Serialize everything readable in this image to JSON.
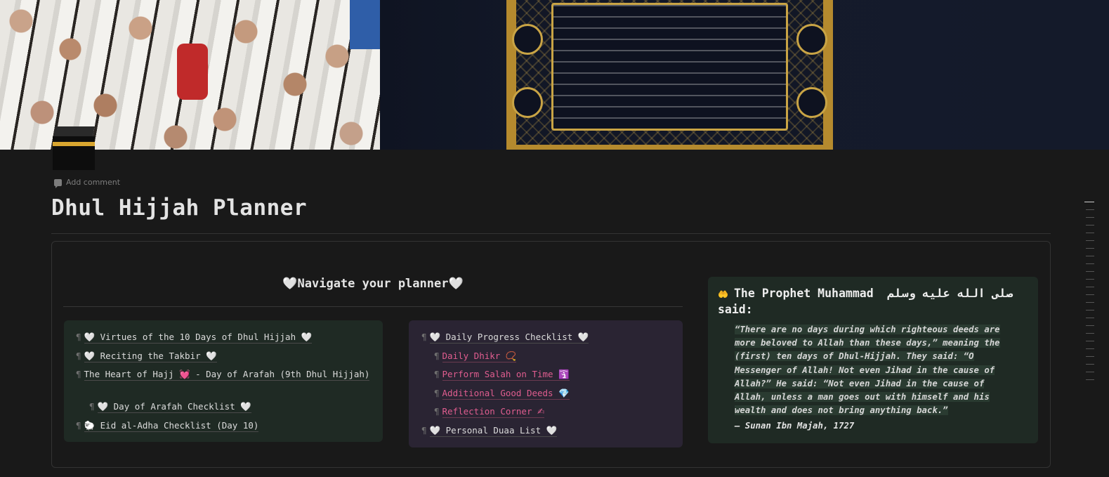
{
  "page": {
    "title": "Dhul Hijjah Planner",
    "add_comment": "Add comment",
    "cover_description": ""
  },
  "icons": {
    "page_icon": "kaaba-icon",
    "heart": "🤍",
    "sheep": "🐑",
    "hands": "🤲",
    "prayer_beads": "📿",
    "person": "🛐",
    "gem": "💎",
    "writing": "✍",
    "broken_heart": "💓",
    "pilcrow": "¶"
  },
  "navigation": {
    "heading": "🤍Navigate your planner🤍",
    "left_items": [
      {
        "pre": "🤍",
        "label": "Virtues of the 10 Days of Dhul Hijjah",
        "post": "🤍"
      },
      {
        "pre": "🤍",
        "label": "Reciting the Takbir",
        "post": "🤍"
      },
      {
        "pre": "",
        "label": "The Heart of Hajj 💓 - Day of Arafah (9th Dhul Hijjah)",
        "post": ""
      },
      {
        "pre": "🤍",
        "label": "Day of Arafah Checklist",
        "post": "🤍"
      },
      {
        "pre": "🐑",
        "label": "Eid al-Adha Checklist (Day 10)",
        "post": ""
      }
    ],
    "mid_items": [
      {
        "pre": "🤍",
        "label": "Daily Progress Checklist",
        "post": "🤍"
      },
      {
        "pre": "",
        "label": "Daily Dhikr",
        "post": "📿"
      },
      {
        "pre": "",
        "label": "Perform Salah on Time",
        "post": "🛐"
      },
      {
        "pre": "",
        "label": "Additional Good Deeds",
        "post": "💎"
      },
      {
        "pre": "",
        "label": "Reflection Corner",
        "post": "✍"
      },
      {
        "pre": "🤍",
        "label": "Personal Duaa List",
        "post": "🤍"
      }
    ]
  },
  "quote": {
    "title_prefix": "The Prophet Muhammad",
    "title_arabic": "صلى الله عليه وسلم",
    "title_suffix": "said:",
    "lines": [
      "“There are no days during which righteous deeds are",
      "more beloved to Allah than these days,” meaning the",
      "(first) ten days of Dhul-Hijjah. They said: “O",
      "Messenger of Allah! Not even Jihad in the cause of",
      "Allah?” He said: “Not even Jihad in the cause of",
      "Allah, unless a man goes out with himself and his",
      "wealth and does not bring anything back.”"
    ],
    "source": "— Sunan Ibn Majah, 1727"
  },
  "colors": {
    "background": "#191919",
    "card_green": "#1f2a24",
    "card_purple": "#2a2433",
    "pink_link": "#e05d8f",
    "text": "#d4d4d4"
  }
}
